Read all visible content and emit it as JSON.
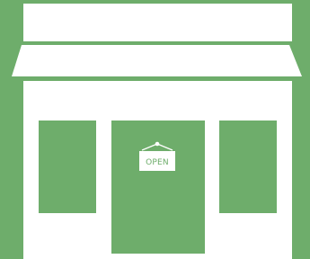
{
  "sign": {
    "label": "OPEN"
  },
  "colors": {
    "background": "#6ead6b",
    "building": "#ffffff"
  },
  "icon": "storefront-icon"
}
